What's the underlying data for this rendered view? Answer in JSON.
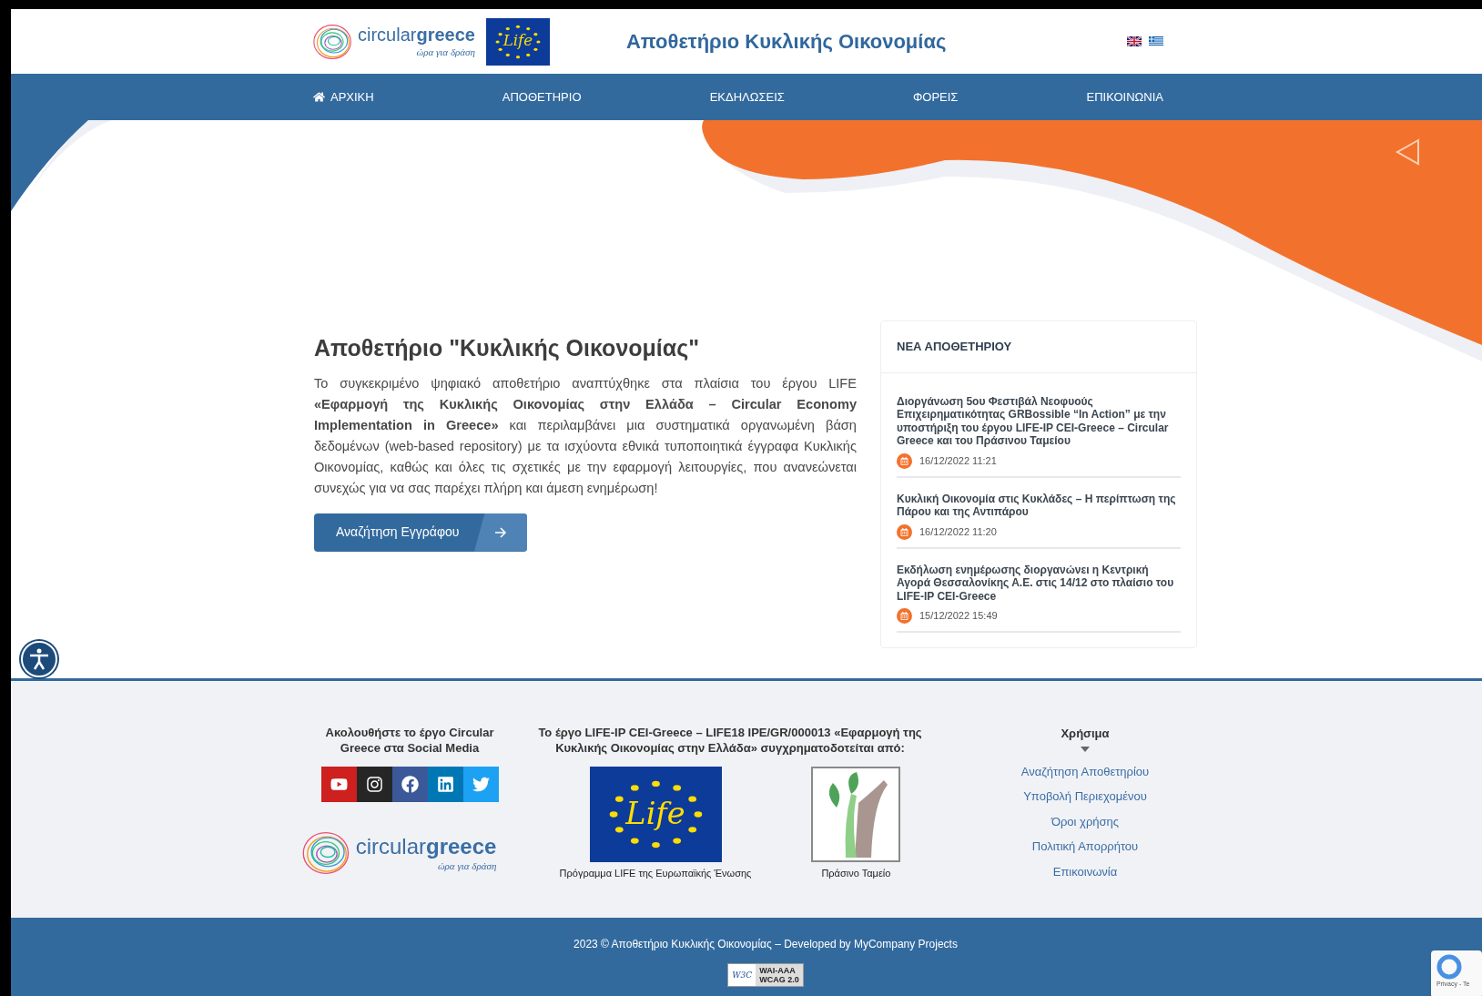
{
  "header": {
    "logo": {
      "light": "circular",
      "bold": "greece",
      "tagline": "ώρα για δράση"
    },
    "life_badge": "Life",
    "title": "Αποθετήριο Κυκλικής Οικονομίας",
    "languages": [
      {
        "kind": "uk"
      },
      {
        "kind": "gr"
      }
    ]
  },
  "nav": [
    {
      "label": "ΑΡΧΙΚΗ",
      "kind": "home"
    },
    {
      "label": "ΑΠΟΘΕΤΗΡΙΟ",
      "kind": "plain"
    },
    {
      "label": "ΕΚΔΗΛΩΣΕΙΣ",
      "kind": "plain"
    },
    {
      "label": "ΦΟΡΕΙΣ",
      "kind": "plain"
    },
    {
      "label": "ΕΠΙΚΟΙΝΩΝΙΑ",
      "kind": "plain"
    }
  ],
  "intro": {
    "heading": "Αποθετήριο \"Κυκλικής Οικονομίας\"",
    "text": "Το συγκεκριμένο ψηφιακό αποθετήριο αναπτύχθηκε στα πλαίσια του έργου LIFE **«Εφαρμογή της Κυκλικής Οικονομίας στην Ελλάδα – Circular Economy Implementation in Greece»** και περιλαμβάνει μια συστηματικά οργανωμένη βάση δεδομένων (web-based repository) με τα ισχύοντα εθνικά τυποποιητικά έγγραφα Κυκλικής Οικονομίας, καθώς και όλες τις σχετικές με την εφαρμογή λειτουργίες, που ανανεώνεται συνεχώς για να σας παρέχει πλήρη και άμεση ενημέρωση!",
    "button": "Αναζήτηση Εγγράφου"
  },
  "news": {
    "title": "ΝΕΑ ΑΠΟΘΕΤΗΡΙΟΥ",
    "items": [
      {
        "title": "Διοργάνωση 5ου Φεστιβάλ Νεοφυούς Επιχειρηματικότητας GRBossible “In Action” με την υποστήριξη του έργου LIFE-IP CEI-Greece – Circular Greece και του Πράσινου Ταμείου",
        "date": "16/12/2022 11:21"
      },
      {
        "title": "Κυκλική Οικονομία στις Κυκλάδες – Η περίπτωση της Πάρου και της Αντιπάρου",
        "date": "16/12/2022 11:20"
      },
      {
        "title": "Εκδήλωση ενημέρωσης διοργανώνει η Κεντρική Αγορά Θεσσαλονίκης Α.Ε. στις 14/12 στο πλαίσιο του LIFE-IP CEI-Greece",
        "date": "15/12/2022 15:49"
      }
    ]
  },
  "footer": {
    "social": {
      "text": "Ακολουθήστε το έργο Circular Greece στα Social Media",
      "links": [
        {
          "kind": "youtube",
          "color": "#cd201f"
        },
        {
          "kind": "instagram",
          "color": "#262626"
        },
        {
          "kind": "facebook",
          "color": "#3b5998"
        },
        {
          "kind": "linkedin",
          "color": "#0077b5"
        },
        {
          "kind": "twitter",
          "color": "#1da1f2"
        }
      ]
    },
    "logo": {
      "light": "circular",
      "bold": "greece",
      "tagline": "ώρα για δράση"
    },
    "funding": {
      "text": "Το έργο LIFE-IP CEI-Greece – LIFE18 IPE/GR/000013 «Εφαρμογή της Κυκλικής Οικονομίας στην Ελλάδα» συγχρηματοδοτείται από:",
      "funders": [
        {
          "kind": "life",
          "logo_text": "Life",
          "caption": "Πρόγραμμα LIFE της Ευρωπαϊκής Ένωσης"
        },
        {
          "kind": "green",
          "caption": "Πράσινο Ταμείο"
        }
      ]
    },
    "useful": {
      "title": "Χρήσιμα",
      "links": [
        "Αναζήτηση Αποθετηρίου",
        "Υποβολή Περιεχομένου",
        "Όροι χρήσης",
        "Πολιτική Απορρήτου",
        "Επικοινωνία"
      ]
    }
  },
  "bottom": {
    "copyright": "2023 © Αποθετήριο Κυκλικής Οικονομίας – Developed by MyCompany Projects",
    "badge": {
      "org": "W3C",
      "level": "WAI-AAA",
      "standard": "WCAG 2.0"
    },
    "recaptcha": "Privacy - Te"
  }
}
